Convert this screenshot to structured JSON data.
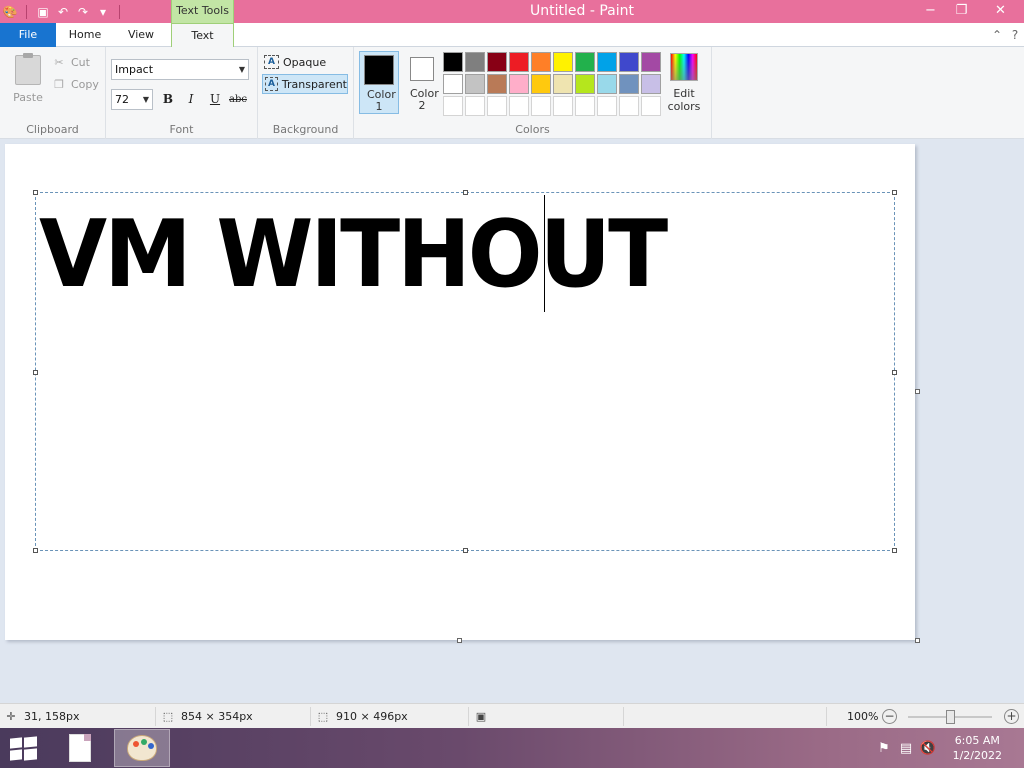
{
  "window": {
    "title": "Untitled - Paint",
    "context_tab": "Text Tools"
  },
  "caption": {
    "minimize": "−",
    "maximize": "❐",
    "close": "✕"
  },
  "tabs": {
    "file": "File",
    "home": "Home",
    "view": "View",
    "text": "Text"
  },
  "ribbon": {
    "clipboard": {
      "paste": "Paste",
      "cut": "Cut",
      "copy": "Copy",
      "label": "Clipboard"
    },
    "font": {
      "family": "Impact",
      "size": "72",
      "bold": "B",
      "italic": "I",
      "underline": "U",
      "strikethrough": "abc",
      "label": "Font"
    },
    "background": {
      "opaque": "Opaque",
      "transparent": "Transparent",
      "label": "Background"
    },
    "colors": {
      "color1_label": "Color 1",
      "color2_label": "Color 2",
      "color1_value": "#000000",
      "color2_value": "#ffffff",
      "edit_label": "Edit colors",
      "label": "Colors",
      "palette_row1": [
        "#000000",
        "#7f7f7f",
        "#880015",
        "#ed1c24",
        "#ff7f27",
        "#fff200",
        "#22b14c",
        "#00a2e8",
        "#3f48cc",
        "#a349a4"
      ],
      "palette_row2": [
        "#ffffff",
        "#c3c3c3",
        "#b97a57",
        "#ffaec9",
        "#ffc90e",
        "#efe4b0",
        "#b5e61d",
        "#99d9ea",
        "#7092be",
        "#c8bfe7"
      ]
    }
  },
  "canvas": {
    "text": "VM WITHOUT"
  },
  "status": {
    "cursor_pos": "31, 158px",
    "selection_size": "854 × 354px",
    "image_size": "910 × 496px",
    "zoom": "100%"
  },
  "taskbar": {
    "time": "6:05 AM",
    "date": "1/2/2022"
  }
}
